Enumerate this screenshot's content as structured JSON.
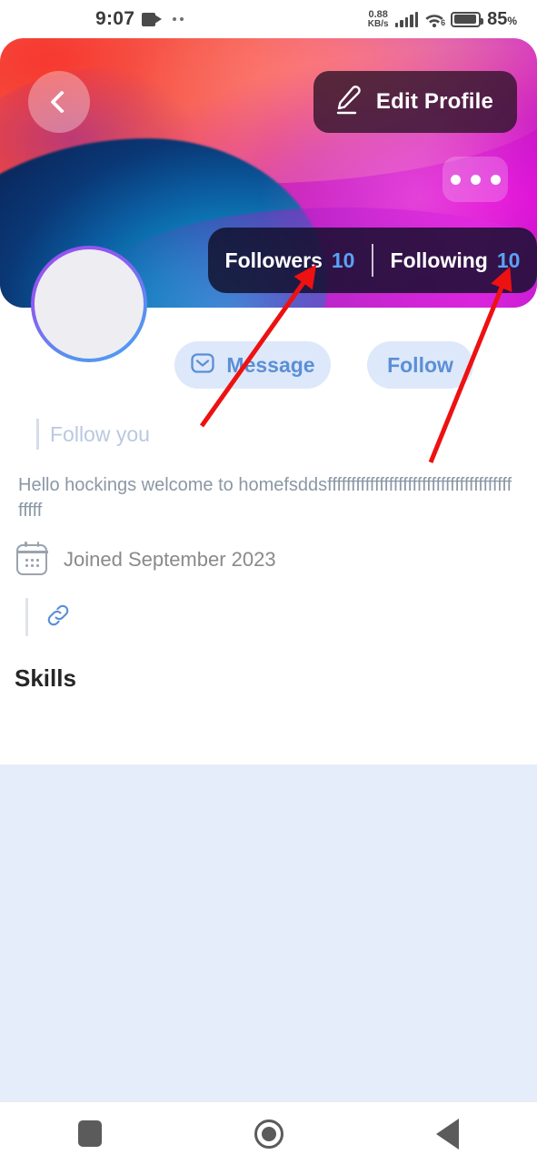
{
  "status_bar": {
    "time": "9:07",
    "camera_icon": "video-camera-icon",
    "dots_icon": "two-dots-icon",
    "network_speed_value": "0.88",
    "network_speed_unit": "KB/s",
    "signal_icon": "cellular-signal-icon",
    "wifi_icon": "wifi-icon",
    "wifi_generation": "6",
    "battery_icon": "battery-icon",
    "battery_percent": "85",
    "battery_percent_symbol": "%"
  },
  "cover": {
    "back_icon": "chevron-left-icon",
    "edit_profile_label": "Edit Profile",
    "edit_icon": "pencil-edit-icon",
    "more_icon": "ellipsis-horizontal-icon"
  },
  "stats": {
    "followers_label": "Followers",
    "followers_count": "10",
    "following_label": "Following",
    "following_count": "10"
  },
  "profile": {
    "avatar_icon": "avatar-placeholder",
    "message_label": "Message",
    "message_icon": "envelope-icon",
    "follow_label": "Follow",
    "follow_you_label": "Follow you",
    "bio": "Hello hockings welcome to homefsddsffffffffffffffffffffffffffffffffffffffffffff",
    "joined_label": "Joined September 2023",
    "calendar_icon": "calendar-icon",
    "link_icon": "link-chain-icon"
  },
  "sections": {
    "skills_title": "Skills"
  },
  "nav_bar": {
    "recents_icon": "square-recents-icon",
    "home_icon": "circle-home-icon",
    "back_icon": "triangle-back-icon"
  },
  "annotations": {
    "arrow_color": "#ee1111",
    "arrow_followers_target": "Followers count",
    "arrow_following_target": "Following count"
  },
  "colors": {
    "accent_blue": "#5aa2f5",
    "pill_bg": "#dde8fa",
    "pill_text": "#5b8fd6",
    "panel_bg": "#e6edfa",
    "bio_text": "#8b97a6"
  }
}
